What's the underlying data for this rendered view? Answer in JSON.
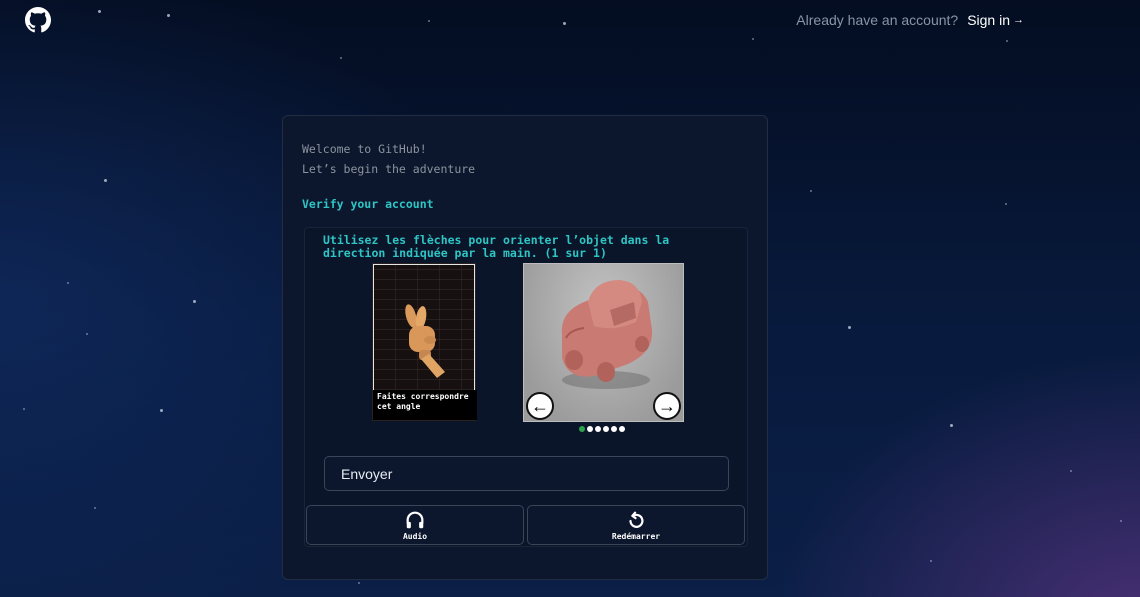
{
  "header": {
    "logo_icon": "github-octocat-icon",
    "account_prompt": "Already have an account?",
    "signin_label": "Sign in",
    "signin_arrow": "→"
  },
  "card": {
    "welcome_line1": "Welcome to GitHub!",
    "welcome_line2": "Let’s begin the adventure",
    "verify_title": "Verify your account"
  },
  "puzzle": {
    "instruction": "Utilisez les flèches pour orienter l’objet dans la direction indiquée par la main. (1 sur 1)",
    "reference_caption": "Faites correspondre cet angle",
    "reference_image_icon": "hand-pointing-icon",
    "object_image_icon": "toy-car-3d-icon",
    "left_arrow": "←",
    "right_arrow": "→",
    "pagination": {
      "total": 6,
      "active_index": 0
    },
    "submit_label": "Envoyer"
  },
  "actions": {
    "audio_label": "Audio",
    "audio_icon": "headphones-icon",
    "restart_label": "Redémarrer",
    "restart_icon": "restart-icon"
  },
  "colors": {
    "accent_teal": "#2ec5c5",
    "background": "#040d21",
    "card": "#0c162d",
    "active_dot": "#2da44e"
  }
}
